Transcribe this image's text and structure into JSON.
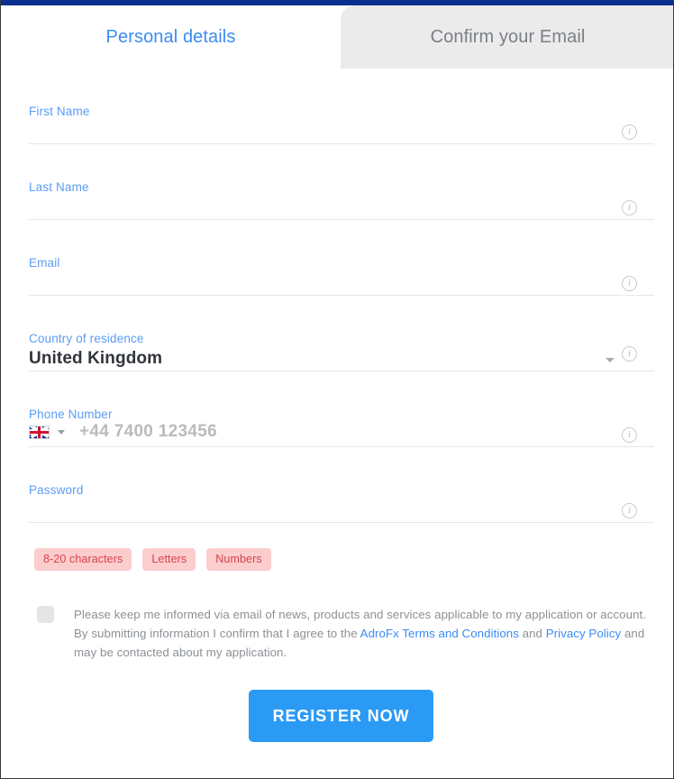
{
  "theme": {
    "top_strip_color": "#0a2f8f",
    "accent_blue": "#3b8cf5",
    "button_blue": "#2b9af5",
    "label_blue": "#5b9cf6",
    "badge_bg": "#fbcdcd",
    "badge_text": "#d8434b",
    "inactive_tab_bg": "#ebebeb"
  },
  "tabs": [
    {
      "label": "Personal details",
      "active": true
    },
    {
      "label": "Confirm your Email",
      "active": false
    }
  ],
  "form": {
    "fields": [
      {
        "label": "First Name",
        "value": "",
        "placeholder": "",
        "info_icon": "info-icon"
      },
      {
        "label": "Last Name",
        "value": "",
        "placeholder": "",
        "info_icon": "info-icon"
      },
      {
        "label": "Email",
        "value": "",
        "placeholder": "",
        "info_icon": "info-icon"
      },
      {
        "label": "Country of residence",
        "value": "United Kingdom",
        "placeholder": "",
        "info_icon": "info-icon",
        "dropdown_icon": "chevron-down-icon"
      },
      {
        "label": "Phone Number",
        "value": "",
        "placeholder": "+44 7400 123456",
        "info_icon": "info-icon",
        "flag_icon": "uk-flag-icon",
        "dropdown_icon": "chevron-down-icon"
      },
      {
        "label": "Password",
        "value": "",
        "placeholder": "",
        "info_icon": "info-icon"
      }
    ],
    "info_glyph": "i"
  },
  "password_rules": [
    "8-20 characters",
    "Letters",
    "Numbers"
  ],
  "consent": {
    "checked": false,
    "text_part1": "Please keep me informed via email of news, products and services applicable to my application or account. By submitting information I confirm that I agree to the ",
    "link1": "AdroFx Terms and Conditions",
    "text_part2": " and ",
    "link2": "Privacy Policy",
    "text_part3": " and may be contacted about my application."
  },
  "submit": {
    "label": "REGISTER NOW"
  }
}
